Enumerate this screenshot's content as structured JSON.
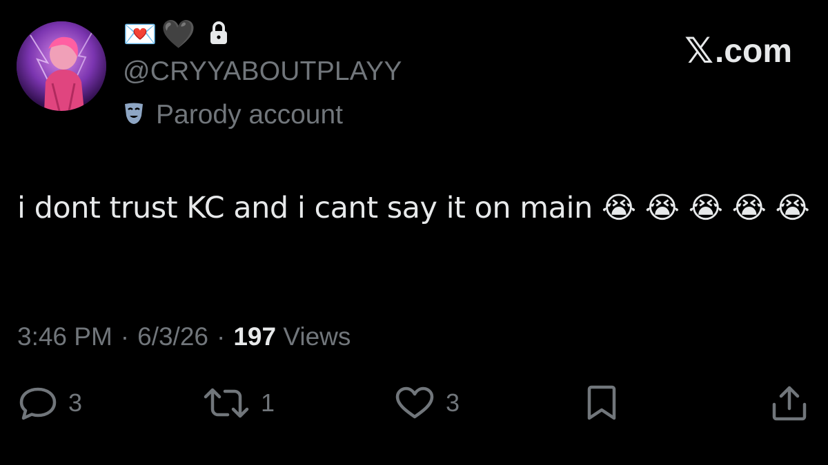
{
  "profile": {
    "name_emojis": [
      "💌",
      "🖤"
    ],
    "handle": "@CRYYABOUTPLAYY",
    "badge_label": "Parody account",
    "lock_icon": "lock-icon",
    "badge_icon": "theater-mask-icon"
  },
  "brand": {
    "x_mark": "𝕏",
    "domain": ".com"
  },
  "tweet": {
    "text": "i dont trust KC and i cant say it on main 😭 😭 😭 😭 😭",
    "time": "3:46 PM",
    "date": "6/3/26",
    "separator": "·",
    "views_count": "197",
    "views_label": "Views"
  },
  "actions": {
    "replies": "3",
    "reposts": "1",
    "likes": "3"
  },
  "colors": {
    "background": "#000000",
    "primary_text": "#e7e9ea",
    "secondary_text": "#71767b"
  }
}
